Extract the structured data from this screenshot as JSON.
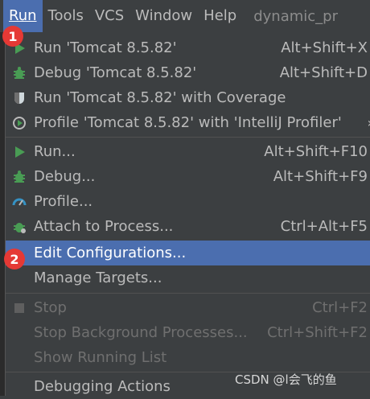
{
  "menubar": {
    "items": [
      {
        "label": "Run",
        "underline": "R",
        "rest": "un"
      },
      {
        "label": "Tools",
        "underline": "T",
        "rest": "ools"
      },
      {
        "label": "VCS",
        "underline": "",
        "rest": "VCS"
      },
      {
        "label": "Window",
        "underline": "W",
        "rest": "indow"
      },
      {
        "label": "Help",
        "underline": "H",
        "rest": "elp"
      }
    ],
    "project": "dynamic_pr"
  },
  "menu": {
    "items": [
      {
        "label": "Run 'Tomcat 8.5.82'",
        "shortcut": "Alt+Shift+X",
        "icon": "run-icon"
      },
      {
        "label": "Debug 'Tomcat 8.5.82'",
        "shortcut": "Alt+Shift+D",
        "icon": "debug-icon"
      },
      {
        "label": "Run 'Tomcat 8.5.82' with Coverage",
        "shortcut": "",
        "icon": "coverage-icon"
      },
      {
        "label": "Profile 'Tomcat 8.5.82' with 'IntelliJ Profiler'",
        "shortcut": "",
        "icon": "profiler-icon"
      },
      {
        "label": "Run...",
        "shortcut": "Alt+Shift+F10",
        "icon": "run-icon"
      },
      {
        "label": "Debug...",
        "shortcut": "Alt+Shift+F9",
        "icon": "debug-icon"
      },
      {
        "label": "Profile...",
        "shortcut": "",
        "icon": "profile-gauge-icon"
      },
      {
        "label": "Attach to Process...",
        "shortcut": "Ctrl+Alt+F5",
        "icon": "attach-process-icon"
      },
      {
        "label": "Edit Configurations...",
        "shortcut": "",
        "icon": ""
      },
      {
        "label": "Manage Targets...",
        "shortcut": "",
        "icon": ""
      },
      {
        "label": "Stop",
        "shortcut": "Ctrl+F2",
        "icon": "stop-icon"
      },
      {
        "label": "Stop Background Processes...",
        "shortcut": "Ctrl+Shift+F2",
        "icon": ""
      },
      {
        "label": "Show Running List",
        "shortcut": "",
        "icon": ""
      },
      {
        "label": "Debugging Actions",
        "shortcut": "",
        "icon": ""
      }
    ]
  },
  "badges": {
    "one": "1",
    "two": "2"
  },
  "watermark": "CSDN @l会飞的鱼",
  "colors": {
    "accent": "#4b6eaf",
    "run_green": "#499c54",
    "badge_red": "#e53935",
    "profile_blue": "#3592c4"
  }
}
